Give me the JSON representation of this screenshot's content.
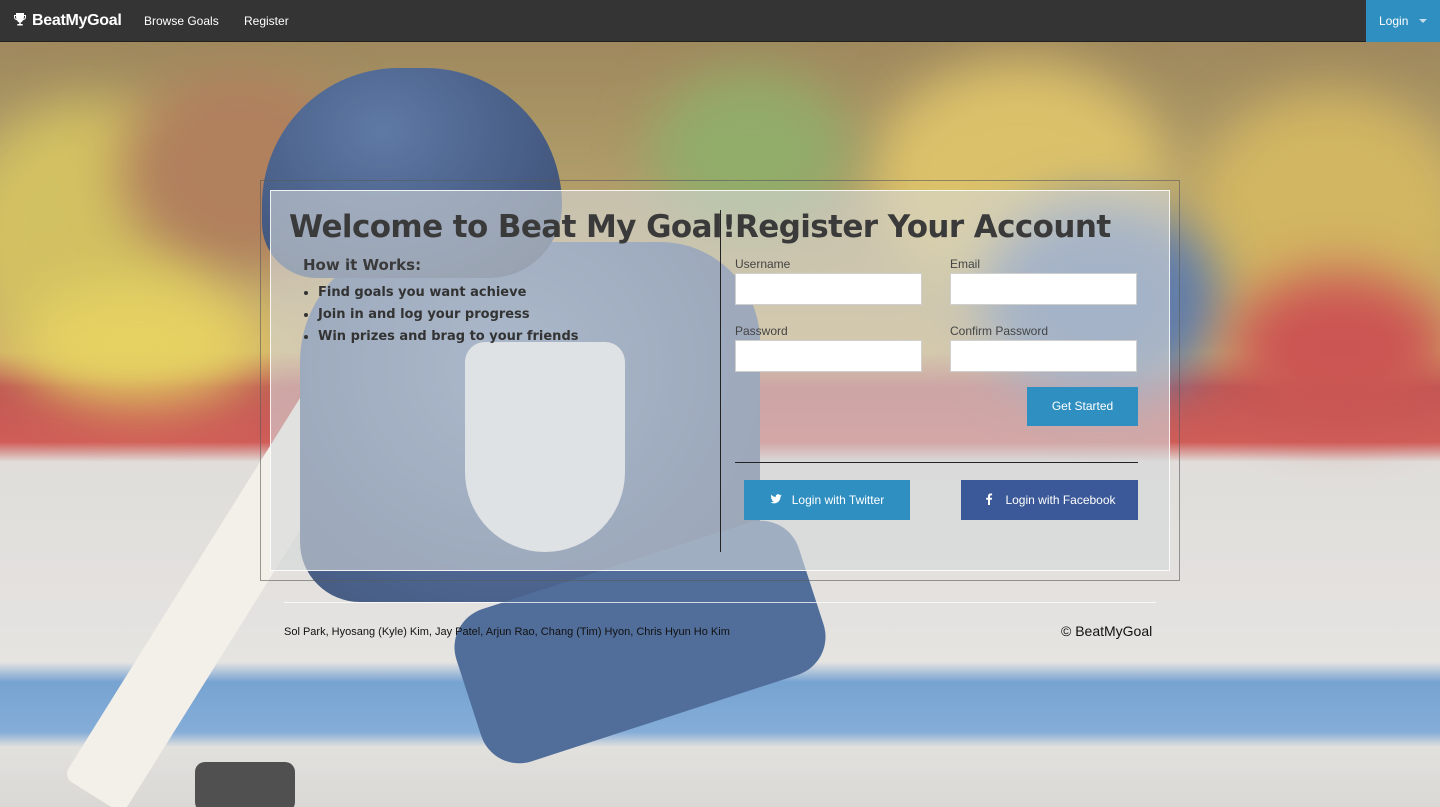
{
  "navbar": {
    "brand": "BeatMyGoal",
    "links": [
      "Browse Goals",
      "Register"
    ],
    "login_label": "Login"
  },
  "welcome": {
    "title": "Welcome to Beat My Goal!",
    "how_title": "How it Works:",
    "steps": [
      "Find goals you want achieve",
      "Join in and log your progress",
      "Win prizes and brag to your friends"
    ]
  },
  "register": {
    "title": "Register Your Account",
    "username_label": "Username",
    "username_value": "",
    "email_label": "Email",
    "email_value": "",
    "password_label": "Password",
    "password_value": "",
    "confirm_label": "Confirm Password",
    "confirm_value": "",
    "submit_label": "Get Started",
    "twitter_label": "Login with Twitter",
    "facebook_label": "Login with Facebook"
  },
  "footer": {
    "credits": "Sol Park, Hyosang (Kyle) Kim, Jay Patel, Arjun Rao, Chang (Tim) Hyon, Chris Hyun Ho Kim",
    "copyright": "© BeatMyGoal"
  },
  "colors": {
    "navbar_bg": "#343434",
    "primary": "#2f8fc1",
    "facebook": "#3b5998",
    "heading": "#3a3a3a"
  },
  "icons": {
    "brand": "trophy-icon",
    "login": "caret-down-icon",
    "twitter": "twitter-icon",
    "facebook": "facebook-icon"
  }
}
